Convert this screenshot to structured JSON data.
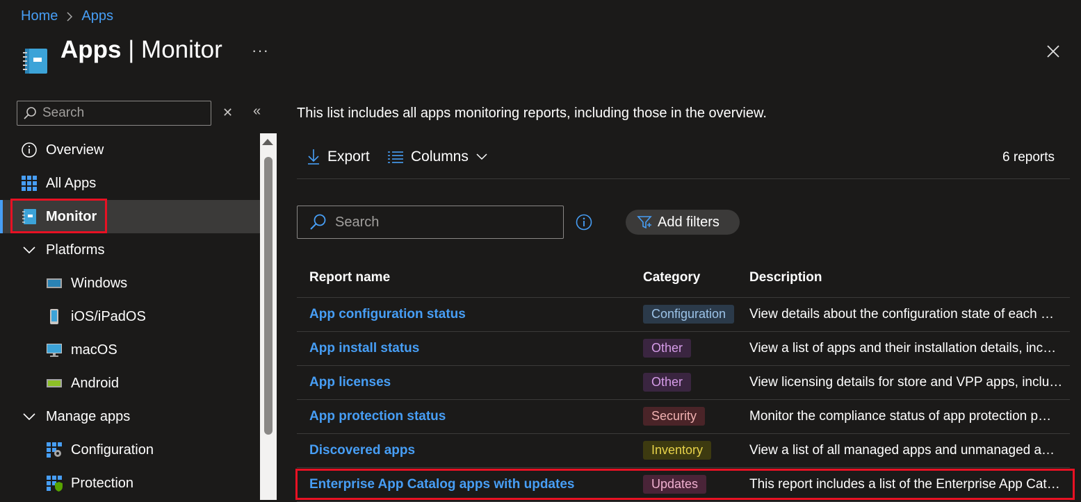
{
  "breadcrumb": {
    "home": "Home",
    "separator": "›",
    "apps": "Apps"
  },
  "header": {
    "title_bold": "Apps",
    "title_rest": " | Monitor",
    "more": "···"
  },
  "sidebar": {
    "search_placeholder": "Search",
    "items": [
      {
        "label": "Overview",
        "icon": "info-icon"
      },
      {
        "label": "All Apps",
        "icon": "grid-icon"
      },
      {
        "label": "Monitor",
        "icon": "monitor-notebook-icon",
        "selected": true
      },
      {
        "label": "Platforms",
        "icon": "chevron-down-icon"
      },
      {
        "label": "Windows",
        "icon": "windows-device-icon"
      },
      {
        "label": "iOS/iPadOS",
        "icon": "phone-icon"
      },
      {
        "label": "macOS",
        "icon": "desktop-icon"
      },
      {
        "label": "Android",
        "icon": "android-device-icon"
      },
      {
        "label": "Manage apps",
        "icon": "chevron-down-icon"
      },
      {
        "label": "Configuration",
        "icon": "grid-gear-icon"
      },
      {
        "label": "Protection",
        "icon": "grid-shield-icon"
      }
    ]
  },
  "main": {
    "intro": "This list includes all apps monitoring reports, including those in the overview.",
    "toolbar": {
      "export": "Export",
      "columns": "Columns",
      "count": "6 reports"
    },
    "search_placeholder": "Search",
    "add_filters": "Add filters",
    "columns": [
      "Report name",
      "Category",
      "Description"
    ],
    "rows": [
      {
        "name": "App configuration status",
        "category": "Configuration",
        "description": "View details about the configuration state of each …"
      },
      {
        "name": "App install status",
        "category": "Other",
        "description": "View a list of apps and their installation details, inc…"
      },
      {
        "name": "App licenses",
        "category": "Other",
        "description": "View licensing details for store and VPP apps, inclu…"
      },
      {
        "name": "App protection status",
        "category": "Security",
        "description": "Monitor the compliance status of app protection p…"
      },
      {
        "name": "Discovered apps",
        "category": "Inventory",
        "description": "View a list of all managed apps and unmanaged a…"
      },
      {
        "name": "Enterprise App Catalog apps with updates",
        "category": "Updates",
        "description": "This report includes a list of the Enterprise App Cat…"
      }
    ]
  },
  "colors": {
    "accent": "#479ef5",
    "highlight": "#e81123",
    "badge_configuration": "#2b3a4a",
    "badge_other": "#3a2540",
    "badge_security": "#4a2428",
    "badge_inventory": "#3d3a10",
    "badge_updates": "#4a2438"
  }
}
